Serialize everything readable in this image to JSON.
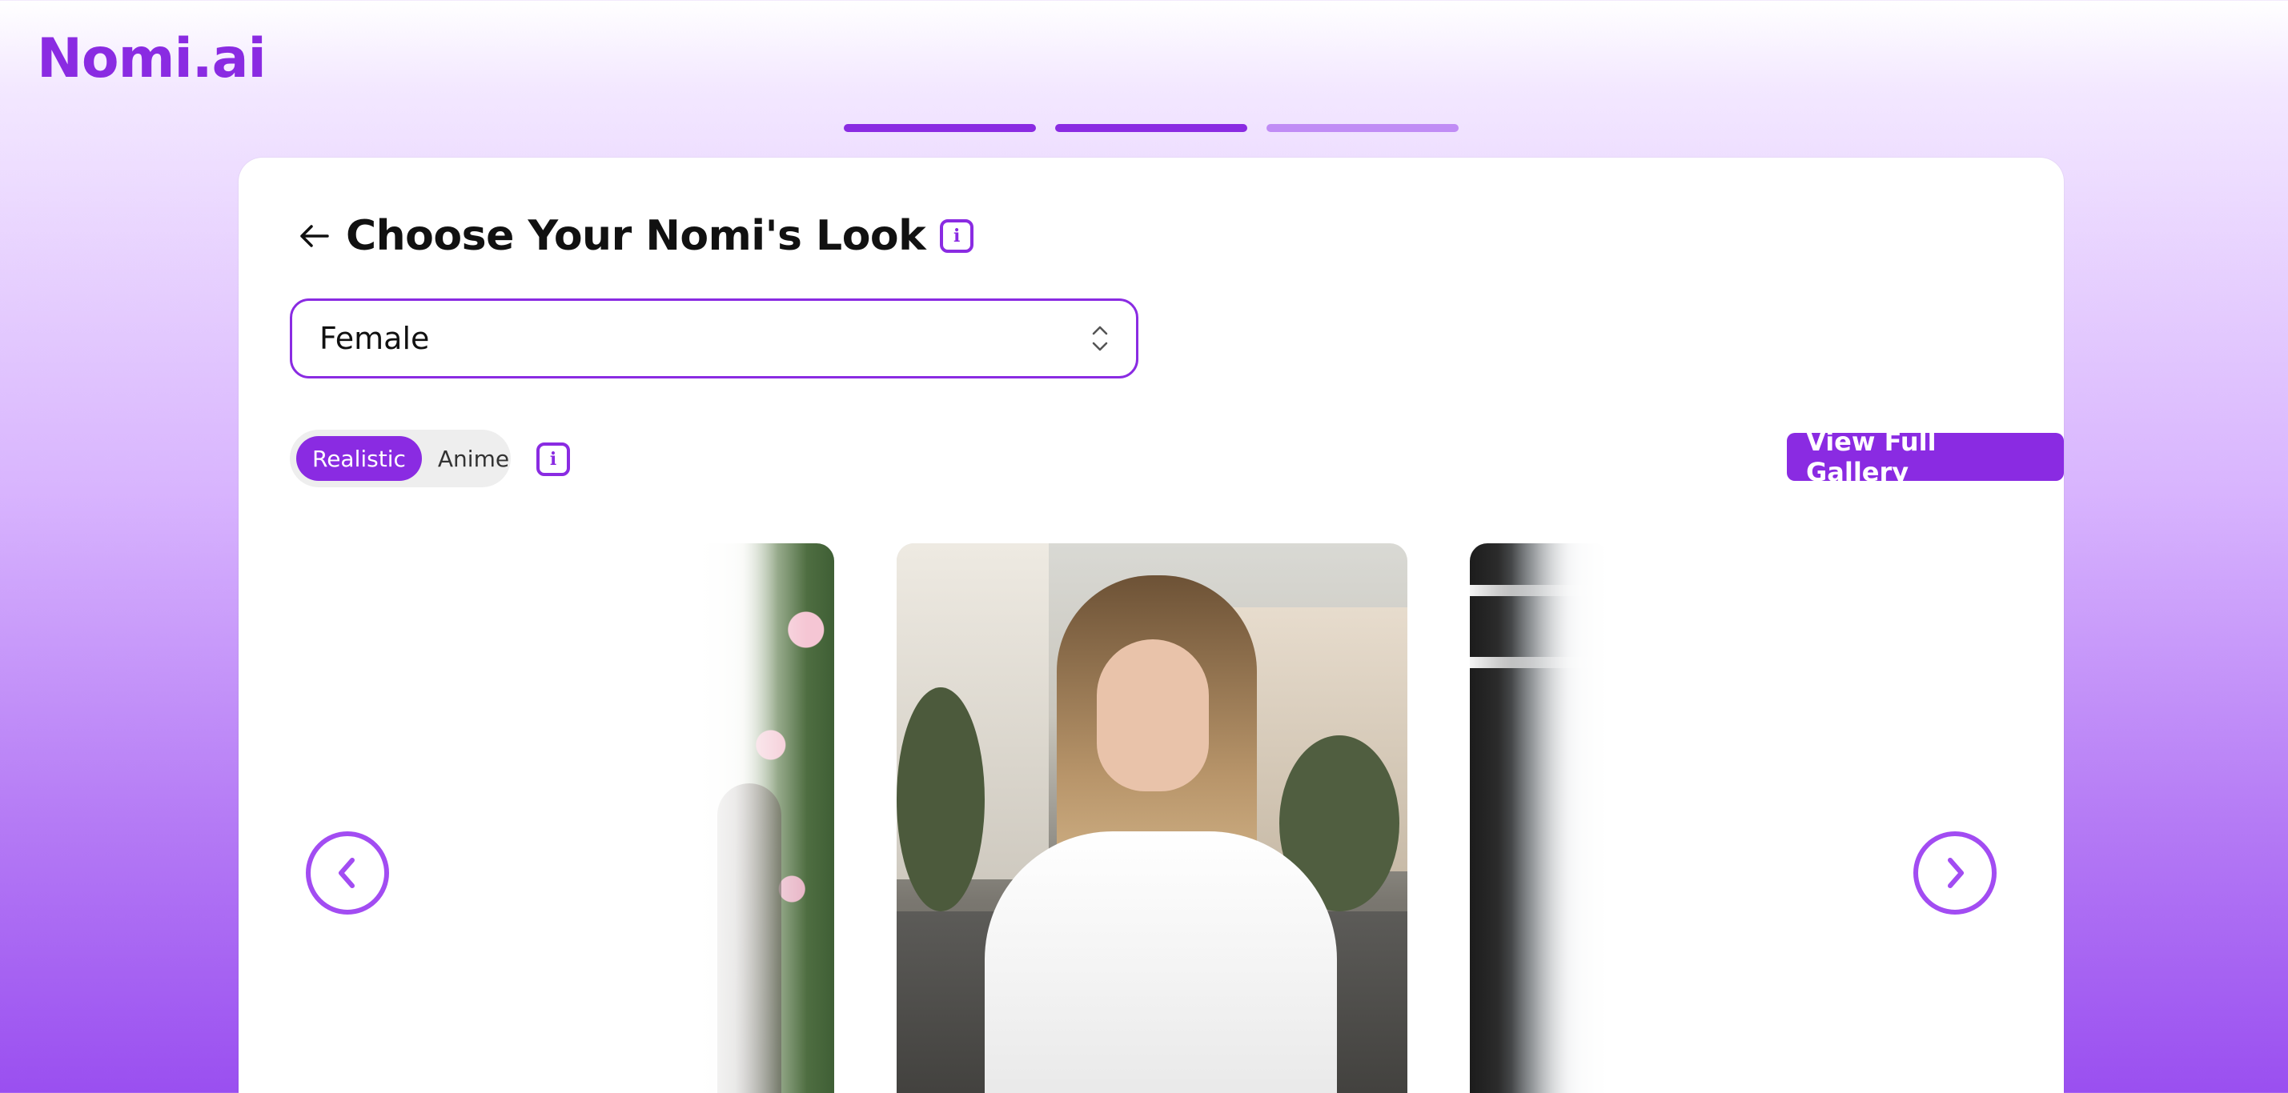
{
  "app": {
    "logo": "Nomi.ai"
  },
  "progress": {
    "steps_total": 3,
    "steps_completed": 2
  },
  "header": {
    "title": "Choose Your Nomi's Look"
  },
  "gender_select": {
    "value": "Female"
  },
  "style_toggle": {
    "options": [
      "Realistic",
      "Anime"
    ],
    "selected": "Realistic"
  },
  "gallery_button": {
    "label": "View Full Gallery"
  },
  "colors": {
    "accent": "#8a2be2",
    "accent_light": "#c08cf5",
    "nav_ring": "#a24cf2"
  },
  "icons": {
    "back": "arrow-left-icon",
    "info": "info-icon",
    "select": "chevron-up-down-icon",
    "prev": "chevron-left-icon",
    "next": "chevron-right-icon"
  }
}
